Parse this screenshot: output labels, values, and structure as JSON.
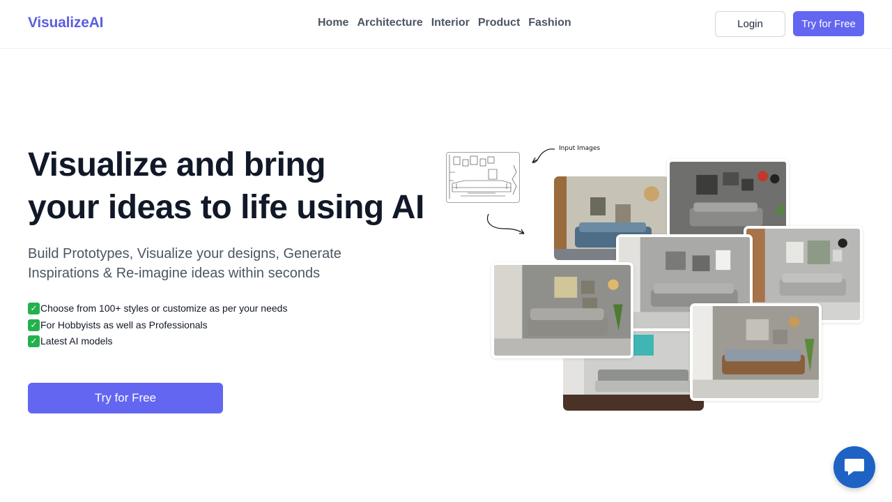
{
  "header": {
    "logo": "VisualizeAI",
    "nav": [
      "Home",
      "Architecture",
      "Interior",
      "Product",
      "Fashion"
    ],
    "login_label": "Login",
    "try_label": "Try for Free"
  },
  "hero": {
    "title_line1": "Visualize and bring",
    "title_line2": "your ideas to life using AI",
    "subtitle_line1": "Build Prototypes, Visualize your designs, Generate",
    "subtitle_line2": "Inspirations & Re-imagine ideas within seconds",
    "features": [
      "Choose from 100+ styles or customize as per your needs",
      "For Hobbyists as well as Professionals",
      "Latest AI models"
    ],
    "cta_label": "Try for Free"
  },
  "collage": {
    "input_label": "Input Images"
  },
  "colors": {
    "brand": "#6366f1",
    "logo": "#5b5fe0",
    "chat": "#1e63c4"
  }
}
